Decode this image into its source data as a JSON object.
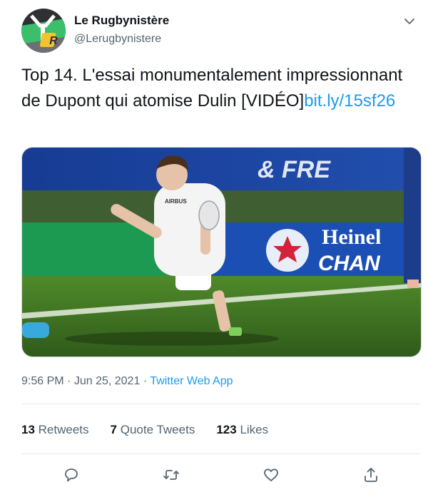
{
  "author": {
    "display_name": "Le Rugbynistère",
    "handle": "@Lerugbynistere",
    "avatar_letter": "R"
  },
  "tweet": {
    "text": "Top 14. L'essai monumentalement impressionnant de Dupont qui atomise Dulin [VIDÉO]",
    "link": "bit.ly/15sf26"
  },
  "media": {
    "banner_text": "& FRE",
    "sponsor_text_1": "Heinel",
    "sponsor_text_2": "CHAN",
    "jersey_brand": "AIRBUS"
  },
  "meta": {
    "time": "9:56 PM",
    "separator": "·",
    "date": "Jun 25, 2021",
    "source": "Twitter Web App"
  },
  "stats": {
    "retweets_count": "13",
    "retweets_label": "Retweets",
    "quotes_count": "7",
    "quotes_label": "Quote Tweets",
    "likes_count": "123",
    "likes_label": "Likes"
  },
  "icons": {
    "more": "chevron-down-icon",
    "reply": "reply-icon",
    "retweet": "retweet-icon",
    "like": "heart-icon",
    "share": "share-icon"
  },
  "colors": {
    "link": "#1d9bf0",
    "secondary_text": "#536471",
    "avatar_bg": "#2e3033",
    "avatar_green": "#3bbf6b",
    "avatar_yellow": "#f2c230"
  }
}
